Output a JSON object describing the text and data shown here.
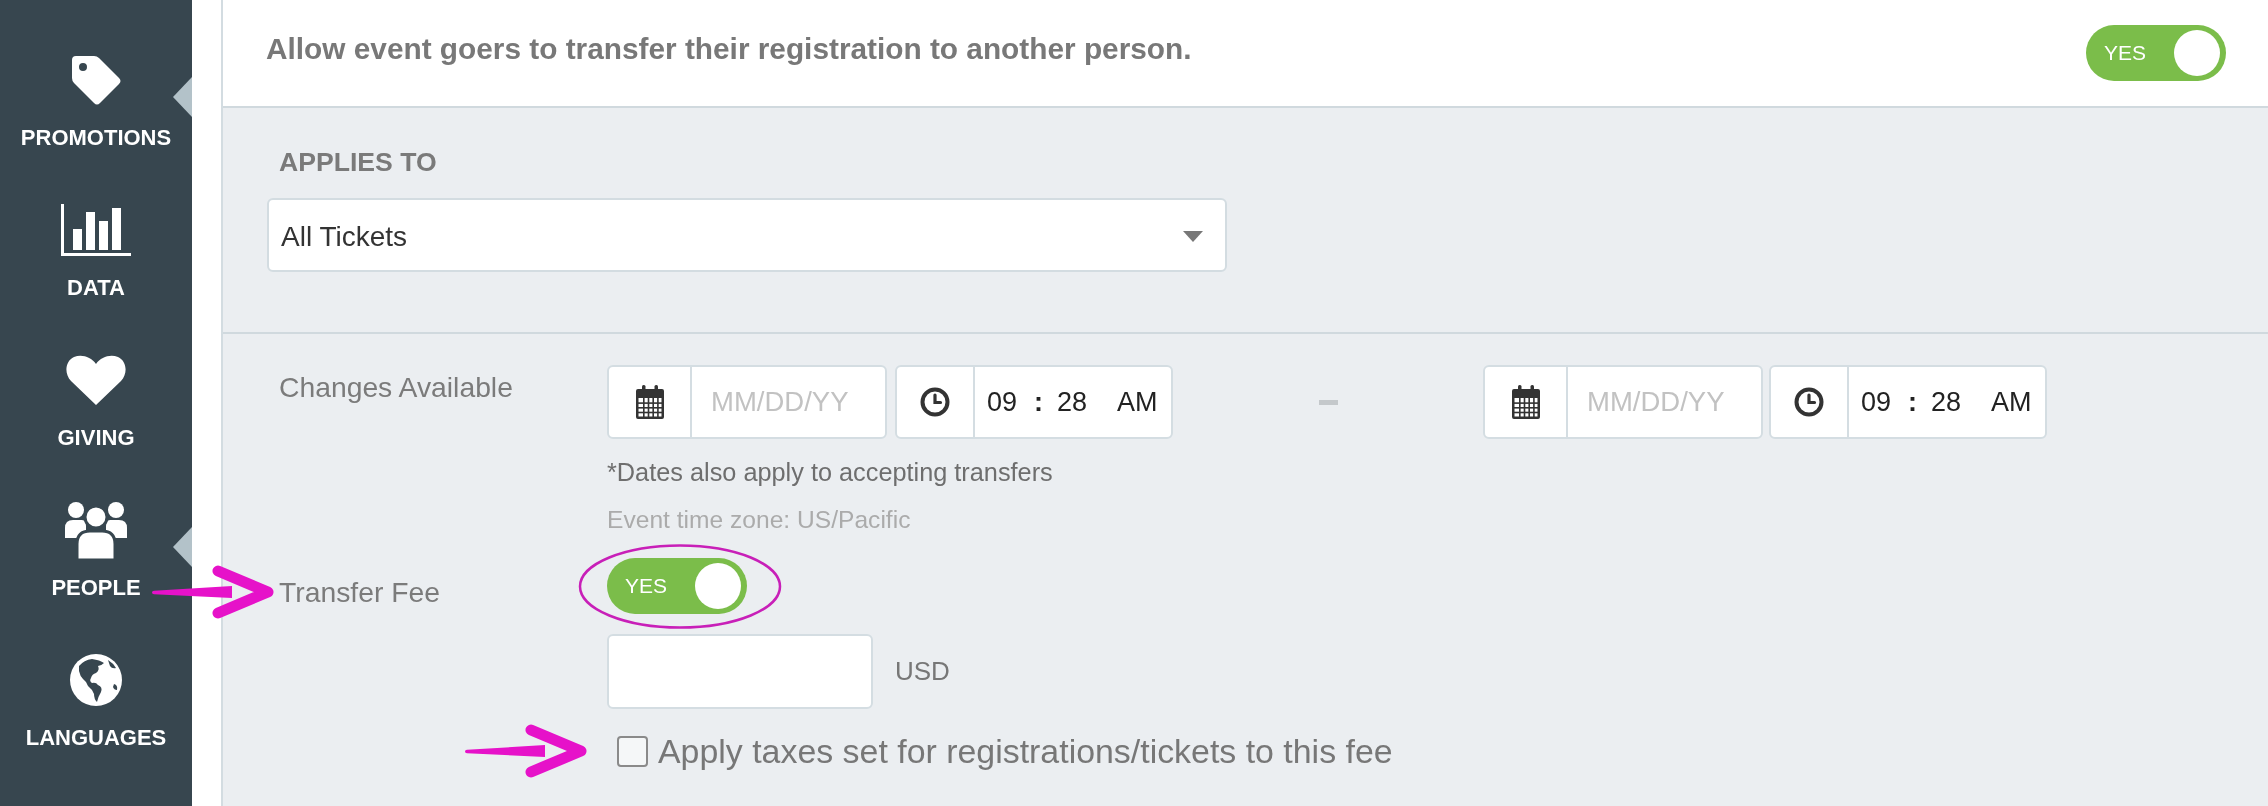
{
  "sidebar": {
    "items": [
      {
        "label": "PROMOTIONS",
        "kind": "tag",
        "notch": true
      },
      {
        "label": "DATA",
        "kind": "chart",
        "notch": false
      },
      {
        "label": "GIVING",
        "kind": "heart",
        "notch": false
      },
      {
        "label": "PEOPLE",
        "kind": "people",
        "notch": true
      },
      {
        "label": "LANGUAGES",
        "kind": "globe",
        "notch": false
      }
    ]
  },
  "transfer_setting": {
    "text": "Allow event goers to transfer their registration to another person.",
    "toggle": {
      "label": "YES",
      "on": true
    }
  },
  "applies_to": {
    "label": "APPLIES TO",
    "select": {
      "value": "All Tickets"
    }
  },
  "changes_available": {
    "label": "Changes Available",
    "start": {
      "date_placeholder": "MM/DD/YY",
      "hour": "09",
      "separator": ":",
      "minute": "28",
      "period": "AM"
    },
    "end": {
      "date_placeholder": "MM/DD/YY",
      "hour": "09",
      "separator": ":",
      "minute": "28",
      "period": "AM"
    },
    "note": "*Dates also apply to accepting transfers",
    "time_zone": "Event time zone: US/Pacific"
  },
  "transfer_fee": {
    "label": "Transfer Fee",
    "pointed_at": true,
    "toggle": {
      "label": "YES",
      "on": true,
      "circled": true
    },
    "amount": {
      "currency": "USD"
    }
  },
  "tax_checkbox": {
    "label": "Apply taxes set for registrations/tickets to this fee",
    "checked": false,
    "pointed_at": true
  }
}
